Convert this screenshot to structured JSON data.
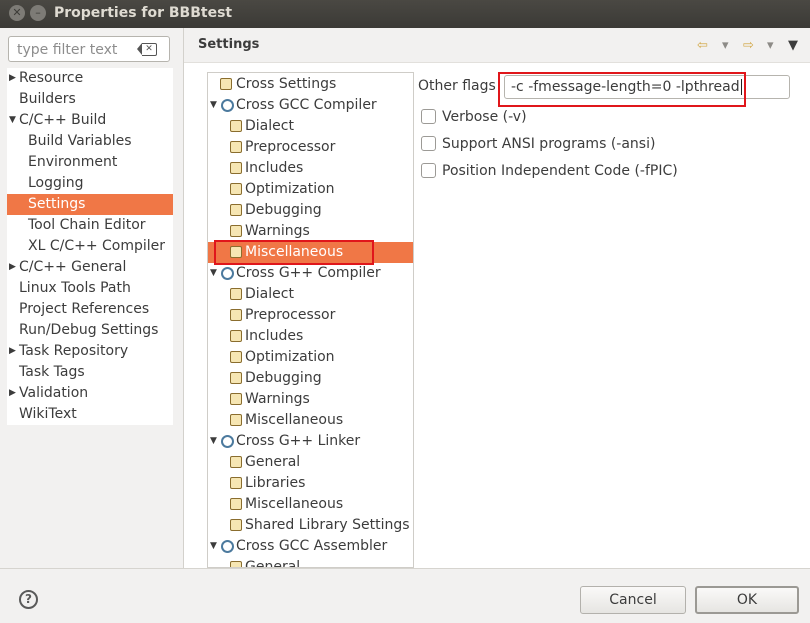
{
  "window": {
    "title": "Properties for BBBtest",
    "close_glyph": "✕",
    "minimize_glyph": "–"
  },
  "filter": {
    "placeholder": "type filter text"
  },
  "nav": {
    "items": [
      {
        "label": "Resource",
        "arrow": "▶",
        "level": 0
      },
      {
        "label": "Builders",
        "arrow": "",
        "level": 0
      },
      {
        "label": "C/C++ Build",
        "arrow": "▼",
        "level": 0
      },
      {
        "label": "Build Variables",
        "arrow": "",
        "level": 1
      },
      {
        "label": "Environment",
        "arrow": "",
        "level": 1
      },
      {
        "label": "Logging",
        "arrow": "",
        "level": 1
      },
      {
        "label": "Settings",
        "arrow": "",
        "level": 1,
        "selected": true
      },
      {
        "label": "Tool Chain Editor",
        "arrow": "",
        "level": 1
      },
      {
        "label": "XL C/C++ Compiler",
        "arrow": "",
        "level": 1
      },
      {
        "label": "C/C++ General",
        "arrow": "▶",
        "level": 0
      },
      {
        "label": "Linux Tools Path",
        "arrow": "",
        "level": 0
      },
      {
        "label": "Project References",
        "arrow": "",
        "level": 0
      },
      {
        "label": "Run/Debug Settings",
        "arrow": "",
        "level": 0
      },
      {
        "label": "Task Repository",
        "arrow": "▶",
        "level": 0
      },
      {
        "label": "Task Tags",
        "arrow": "",
        "level": 0
      },
      {
        "label": "Validation",
        "arrow": "▶",
        "level": 0
      },
      {
        "label": "WikiText",
        "arrow": "",
        "level": 0
      }
    ]
  },
  "header": {
    "title": "Settings",
    "back_glyph": "⇦",
    "forward_glyph": "⇨",
    "menu_glyph": "▾",
    "view_menu_glyph": "▼"
  },
  "tools": {
    "items": [
      {
        "label": "Cross Settings",
        "icon": "settings-icon",
        "group": false
      },
      {
        "label": "Cross GCC Compiler",
        "icon": "gear-icon",
        "group": true,
        "arrow": "▼"
      },
      {
        "label": "Dialect",
        "icon": "settings-icon",
        "group": false
      },
      {
        "label": "Preprocessor",
        "icon": "settings-icon",
        "group": false
      },
      {
        "label": "Includes",
        "icon": "settings-icon",
        "group": false
      },
      {
        "label": "Optimization",
        "icon": "settings-icon",
        "group": false
      },
      {
        "label": "Debugging",
        "icon": "settings-icon",
        "group": false
      },
      {
        "label": "Warnings",
        "icon": "settings-icon",
        "group": false
      },
      {
        "label": "Miscellaneous",
        "icon": "settings-icon",
        "group": false,
        "selected": true
      },
      {
        "label": "Cross G++ Compiler",
        "icon": "gear-icon",
        "group": true,
        "arrow": "▼"
      },
      {
        "label": "Dialect",
        "icon": "settings-icon",
        "group": false
      },
      {
        "label": "Preprocessor",
        "icon": "settings-icon",
        "group": false
      },
      {
        "label": "Includes",
        "icon": "settings-icon",
        "group": false
      },
      {
        "label": "Optimization",
        "icon": "settings-icon",
        "group": false
      },
      {
        "label": "Debugging",
        "icon": "settings-icon",
        "group": false
      },
      {
        "label": "Warnings",
        "icon": "settings-icon",
        "group": false
      },
      {
        "label": "Miscellaneous",
        "icon": "settings-icon",
        "group": false
      },
      {
        "label": "Cross G++ Linker",
        "icon": "gear-icon",
        "group": true,
        "arrow": "▼"
      },
      {
        "label": "General",
        "icon": "settings-icon",
        "group": false
      },
      {
        "label": "Libraries",
        "icon": "settings-icon",
        "group": false
      },
      {
        "label": "Miscellaneous",
        "icon": "settings-icon",
        "group": false
      },
      {
        "label": "Shared Library Settings",
        "icon": "settings-icon",
        "group": false
      },
      {
        "label": "Cross GCC Assembler",
        "icon": "gear-icon",
        "group": true,
        "arrow": "▼"
      },
      {
        "label": "General",
        "icon": "settings-icon",
        "group": false
      }
    ]
  },
  "form": {
    "other_flags_label": "Other flags",
    "other_flags_value": "-c -fmessage-length=0 -lpthread",
    "checkboxes": [
      {
        "label": "Verbose (-v)",
        "checked": false
      },
      {
        "label": "Support ANSI programs (-ansi)",
        "checked": false
      },
      {
        "label": "Position Independent Code (-fPIC)",
        "checked": false
      }
    ]
  },
  "footer": {
    "help_glyph": "?",
    "cancel_label": "Cancel",
    "ok_label": "OK"
  },
  "colors": {
    "selection": "#f07746",
    "highlight_box": "#e0161b"
  }
}
